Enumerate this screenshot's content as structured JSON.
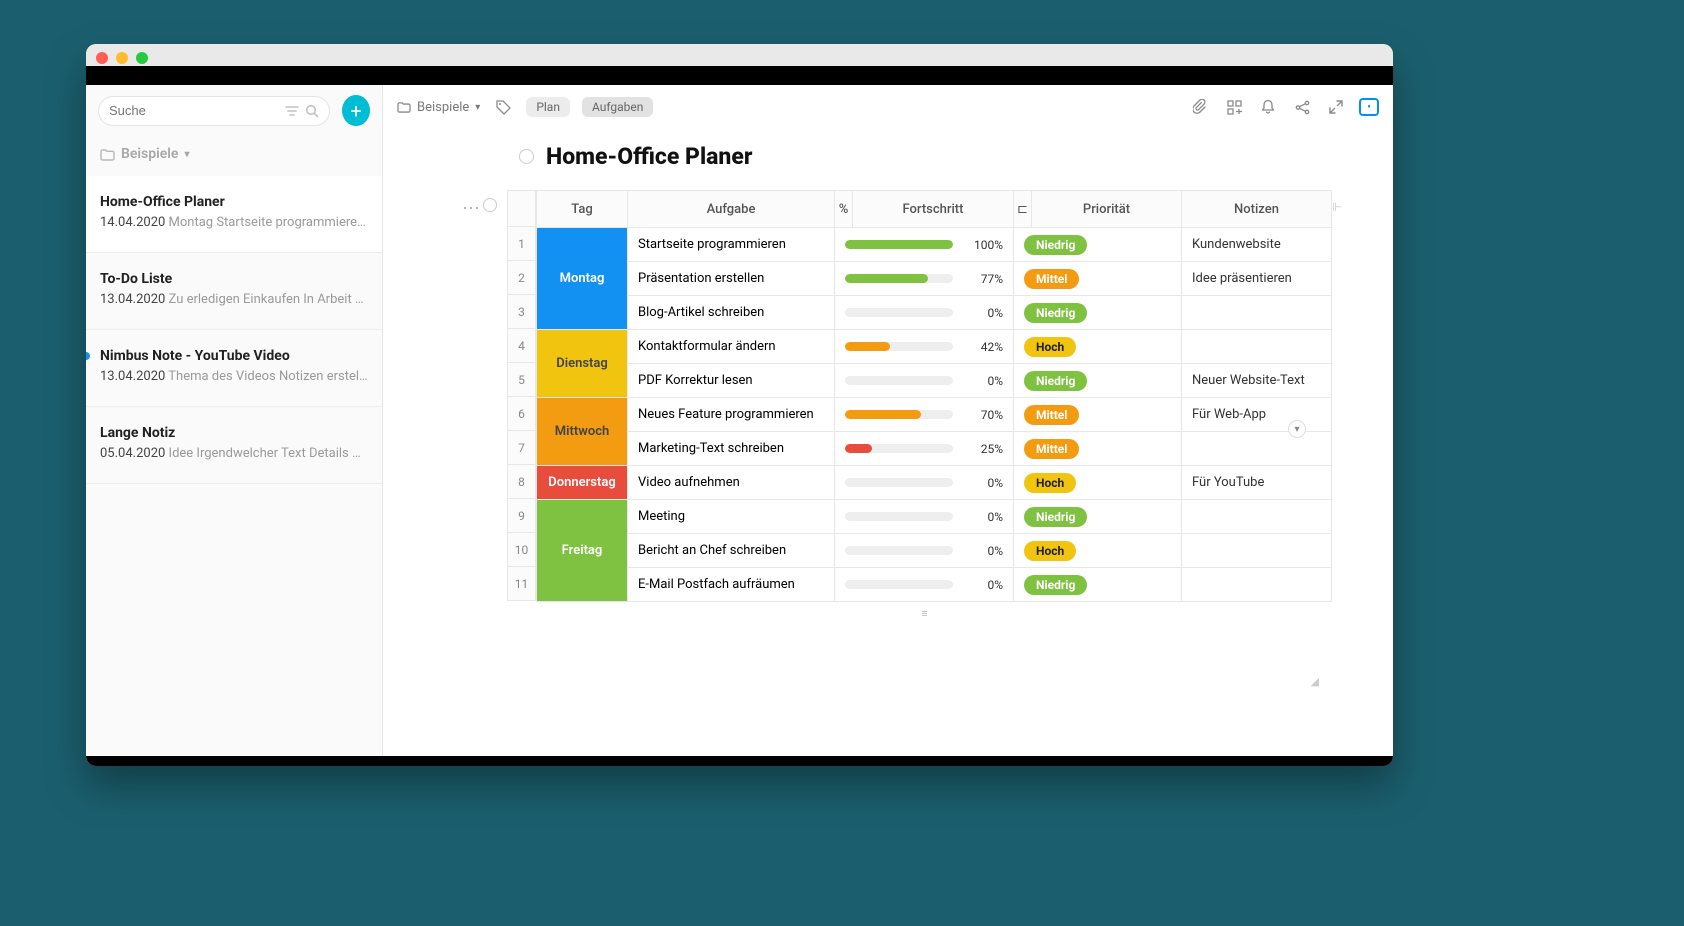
{
  "search": {
    "placeholder": "Suche"
  },
  "sidebar": {
    "breadcrumb": "Beispiele",
    "notes": [
      {
        "title": "Home-Office Planer",
        "date": "14.04.2020",
        "preview": "Montag Startseite programmieren …",
        "selected": true,
        "unread": false
      },
      {
        "title": "To-Do Liste",
        "date": "13.04.2020",
        "preview": "Zu erledigen Einkaufen In Arbeit V…",
        "selected": false,
        "unread": false
      },
      {
        "title": "Nimbus Note - YouTube Video",
        "date": "13.04.2020",
        "preview": "Thema des Videos Notizen erstell…",
        "selected": false,
        "unread": true
      },
      {
        "title": "Lange Notiz",
        "date": "05.04.2020",
        "preview": "Idee Irgendwelcher Text Details A …",
        "selected": false,
        "unread": false
      }
    ]
  },
  "header": {
    "breadcrumb": "Beispiele",
    "chips": [
      "Plan",
      "Aufgaben"
    ]
  },
  "doc": {
    "title": "Home-Office Planer"
  },
  "table": {
    "headers": {
      "tag": "Tag",
      "aufgabe": "Aufgabe",
      "pct": "%",
      "fortschritt": "Fortschritt",
      "prio_icon": "⊏",
      "prio": "Priorität",
      "notizen": "Notizen"
    }
  },
  "priority_labels": {
    "low": "Niedrig",
    "mid": "Mittel",
    "high": "Hoch"
  },
  "days": [
    {
      "name": "Montag",
      "class": "day-mon",
      "rows": [
        {
          "idx": 1,
          "task": "Startseite programmieren",
          "pct": 100,
          "bar_color": "#7fc241",
          "prio": "low",
          "note": "Kundenwebsite"
        },
        {
          "idx": 2,
          "task": "Präsentation erstellen",
          "pct": 77,
          "bar_color": "#7fc241",
          "prio": "mid",
          "note": "Idee präsentieren"
        },
        {
          "idx": 3,
          "task": "Blog-Artikel schreiben",
          "pct": 0,
          "bar_color": "#7fc241",
          "prio": "low",
          "note": ""
        }
      ]
    },
    {
      "name": "Dienstag",
      "class": "day-tue",
      "rows": [
        {
          "idx": 4,
          "task": "Kontaktformular ändern",
          "pct": 42,
          "bar_color": "#f39c12",
          "prio": "high",
          "note": ""
        },
        {
          "idx": 5,
          "task": "PDF Korrektur lesen",
          "pct": 0,
          "bar_color": "#7fc241",
          "prio": "low",
          "note": "Neuer Website-Text"
        }
      ]
    },
    {
      "name": "Mittwoch",
      "class": "day-wed",
      "rows": [
        {
          "idx": 6,
          "task": "Neues Feature programmieren",
          "pct": 70,
          "bar_color": "#f39c12",
          "prio": "mid",
          "note": "Für Web-App"
        },
        {
          "idx": 7,
          "task": "Marketing-Text schreiben",
          "pct": 25,
          "bar_color": "#e74c3c",
          "prio": "mid",
          "note": ""
        }
      ]
    },
    {
      "name": "Donnerstag",
      "class": "day-thu",
      "rows": [
        {
          "idx": 8,
          "task": "Video aufnehmen",
          "pct": 0,
          "bar_color": "#7fc241",
          "prio": "high",
          "note": "Für YouTube"
        }
      ]
    },
    {
      "name": "Freitag",
      "class": "day-fri",
      "rows": [
        {
          "idx": 9,
          "task": "Meeting",
          "pct": 0,
          "bar_color": "#7fc241",
          "prio": "low",
          "note": ""
        },
        {
          "idx": 10,
          "task": "Bericht an Chef schreiben",
          "pct": 0,
          "bar_color": "#7fc241",
          "prio": "high",
          "note": ""
        },
        {
          "idx": 11,
          "task": "E-Mail Postfach aufräumen",
          "pct": 0,
          "bar_color": "#7fc241",
          "prio": "low",
          "note": ""
        }
      ]
    }
  ]
}
